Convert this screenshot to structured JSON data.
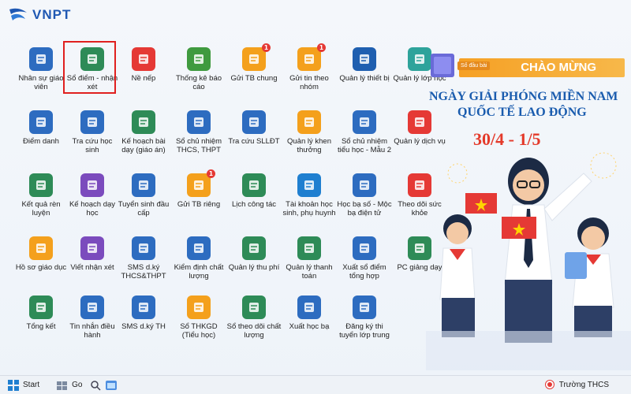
{
  "logo": {
    "text": "VNPT"
  },
  "apps": [
    {
      "label": "Nhân sự giáo viên",
      "icon": "id-card-icon",
      "color": "#2d6cc0"
    },
    {
      "label": "Sổ điểm - nhận xét",
      "icon": "gradebook-icon",
      "color": "#2e8b57"
    },
    {
      "label": "Nề nếp",
      "icon": "warning-icon",
      "color": "#e53935"
    },
    {
      "label": "Thống kê báo cáo",
      "icon": "clipboard-chart-icon",
      "color": "#3f9a3f"
    },
    {
      "label": "Gửi TB chung",
      "icon": "bell-icon",
      "color": "#f4a01c",
      "badge": "1"
    },
    {
      "label": "Gửi tin theo nhóm",
      "icon": "bell-icon",
      "color": "#f4a01c",
      "badge": "1"
    },
    {
      "label": "Quản lý thiết bị",
      "icon": "globe-icon",
      "color": "#1f5fb0"
    },
    {
      "label": "Quản lý lớp học",
      "icon": "group-icon",
      "color": "#2ea39b"
    },
    {
      "label": "Điểm danh",
      "icon": "checklist-icon",
      "color": "#2d6cc0"
    },
    {
      "label": "Tra cứu học sinh",
      "icon": "search-window-icon",
      "color": "#2d6cc0"
    },
    {
      "label": "Kế hoạch bài dạy (giáo án)",
      "icon": "plan-icon",
      "color": "#2e8b57"
    },
    {
      "label": "Sổ chủ nhiệm THCS, THPT",
      "icon": "book-icon",
      "color": "#2d6cc0"
    },
    {
      "label": "Tra cứu SLLĐT",
      "icon": "search-doc-icon",
      "color": "#2d6cc0"
    },
    {
      "label": "Quản lý khen thưởng",
      "icon": "medal-icon",
      "color": "#f4a01c"
    },
    {
      "label": "Sổ chủ nhiệm tiểu học - Mẫu 2",
      "icon": "book-icon",
      "color": "#2d6cc0"
    },
    {
      "label": "Quản lý dịch vụ",
      "icon": "store-icon",
      "color": "#e53935"
    },
    {
      "label": "Kết quả rèn luyện",
      "icon": "growth-icon",
      "color": "#2e8b57"
    },
    {
      "label": "Kế hoạch dạy học",
      "icon": "calendar-icon",
      "color": "#7b4bbd"
    },
    {
      "label": "Tuyển sinh đầu cấp",
      "icon": "laptop-icon",
      "color": "#2d6cc0"
    },
    {
      "label": "Gửi TB riêng",
      "icon": "bell-icon",
      "color": "#f4a01c",
      "badge": "1"
    },
    {
      "label": "Lịch công tác",
      "icon": "calendar-grid-icon",
      "color": "#2e8b57"
    },
    {
      "label": "Tài khoản học sinh, phụ huynh",
      "icon": "user-circle-icon",
      "color": "#1f7fd0"
    },
    {
      "label": "Học bạ số - Mộc bạ điện tử",
      "icon": "digital-record-icon",
      "color": "#2d6cc0"
    },
    {
      "label": "Theo dõi sức khỏe",
      "icon": "medical-icon",
      "color": "#e53935"
    },
    {
      "label": "Hồ sơ giáo dục",
      "icon": "folder-doc-icon",
      "color": "#f4a01c"
    },
    {
      "label": "Viết nhận xét",
      "icon": "note-icon",
      "color": "#7b4bbd"
    },
    {
      "label": "SMS d.ký THCS&THPT",
      "icon": "sms-icon",
      "color": "#2d6cc0"
    },
    {
      "label": "Kiểm định chất lượng",
      "icon": "monitor-check-icon",
      "color": "#2d6cc0"
    },
    {
      "label": "Quản lý thu phí",
      "icon": "money-doc-icon",
      "color": "#2e8b57"
    },
    {
      "label": "Quản lý thanh toán",
      "icon": "phone-pay-icon",
      "color": "#2e8b57"
    },
    {
      "label": "Xuất sổ điểm tổng hợp",
      "icon": "export-grid-icon",
      "color": "#2d6cc0"
    },
    {
      "label": "PC giảng dạy",
      "icon": "blackboard-icon",
      "color": "#2e8b57"
    },
    {
      "label": "Tổng kết",
      "icon": "summary-icon",
      "color": "#2e8b57"
    },
    {
      "label": "Tin nhắn điều hành",
      "icon": "chat-icon",
      "color": "#2d6cc0"
    },
    {
      "label": "SMS d.ký TH",
      "icon": "sms-icon",
      "color": "#2d6cc0"
    },
    {
      "label": "Sổ THKGD (Tiểu học)",
      "icon": "book-t-icon",
      "color": "#f4a01c"
    },
    {
      "label": "Sổ theo dõi chất lượng",
      "icon": "chart-doc-icon",
      "color": "#2e8b57"
    },
    {
      "label": "Xuất học bạ",
      "icon": "export-doc-icon",
      "color": "#2d6cc0"
    },
    {
      "label": "Đăng ký thi tuyển lớp trung",
      "icon": "list-check-icon",
      "color": "#2d6cc0"
    }
  ],
  "banner": {
    "small_tag": "Sổ đầu bài",
    "ribbon": "CHÀO MỪNG",
    "title1": "NGÀY GIẢI PHÓNG MIỀN NAM",
    "title2": "QUỐC TẾ LAO ĐỘNG",
    "date": "30/4 - 1/5"
  },
  "taskbar": {
    "start": "Start",
    "go": "Go",
    "school": "Trường THCS"
  }
}
